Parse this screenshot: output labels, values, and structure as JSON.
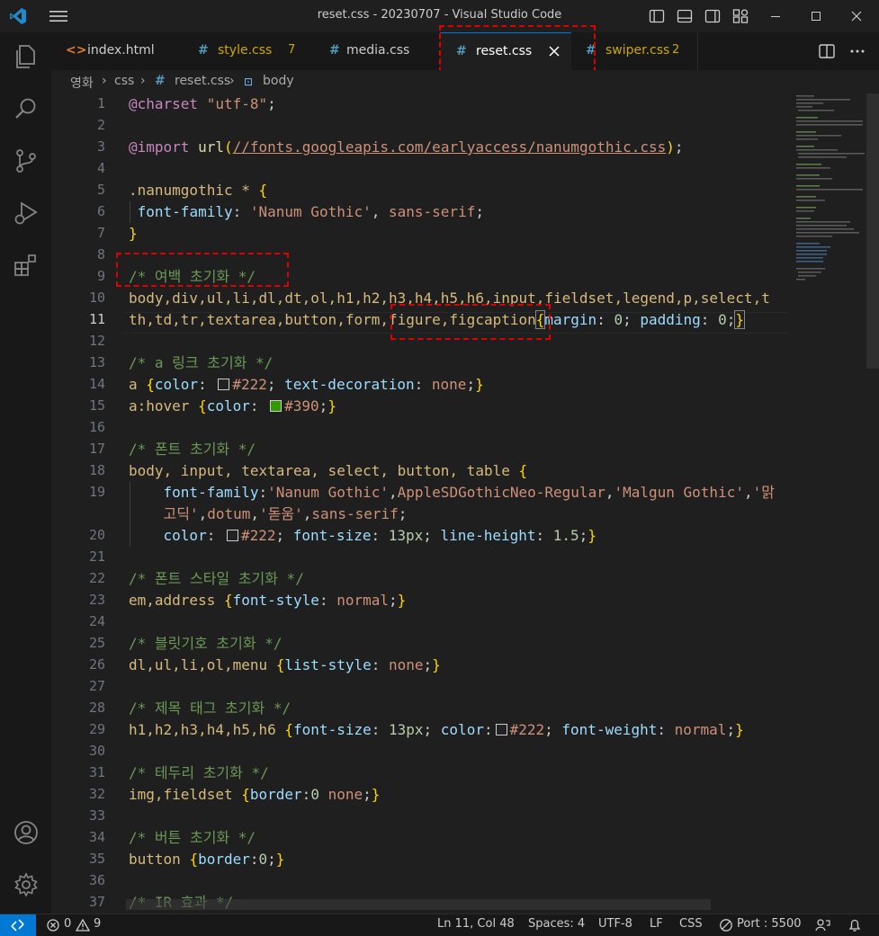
{
  "window": {
    "title": "reset.css - 20230707 - Visual Studio Code"
  },
  "tabs": [
    {
      "label": "index.html",
      "icon": "<>",
      "color": "#cccccc",
      "badge": "",
      "active": false
    },
    {
      "label": "style.css",
      "icon": "#",
      "color": "#cca700",
      "badge": "7",
      "active": false
    },
    {
      "label": "media.css",
      "icon": "#",
      "color": "#cccccc",
      "badge": "",
      "active": false
    },
    {
      "label": "reset.css",
      "icon": "#",
      "color": "#ffffff",
      "badge": "",
      "active": true
    },
    {
      "label": "swiper.css",
      "icon": "#",
      "color": "#cca700",
      "badge": "2",
      "active": false
    }
  ],
  "breadcrumb": {
    "root": "영화",
    "folder": "css",
    "file_icon": "#",
    "file": "reset.css",
    "symbol": "body"
  },
  "line_numbers": [
    "1",
    "2",
    "3",
    "4",
    "5",
    "6",
    "7",
    "8",
    "9",
    "10",
    "11",
    "12",
    "13",
    "14",
    "15",
    "16",
    "17",
    "18",
    "19",
    "20",
    "21",
    "22",
    "23",
    "24",
    "25",
    "26",
    "27",
    "28",
    "29",
    "30",
    "31",
    "32",
    "33",
    "34",
    "35",
    "36",
    "37"
  ],
  "code": {
    "l1_kw": "@charset",
    "l1_str": "\"utf-8\"",
    "semi": ";",
    "l3_kw": "@import",
    "l3_fn": "url",
    "l3_url": "//fonts.googleapis.com/earlyaccess/nanumgothic.css",
    "l5_sel": ".nanumgothic * ",
    "open": "{",
    "close": "}",
    "l6_prop": "font-family",
    "l6_str": "'Nanum Gothic'",
    "l6_val": "sans-serif",
    "l9_cmt": "/* 여백 초기화 */",
    "l10_sel": "body,div,ul,li,dl,dt,ol,h1,h2,h3,h4,h5,h6,input,fieldset,legend,p,select,t",
    "l11_sel": "th,td,tr,textarea,button,form,figure,figcaption",
    "l11_p1": "margin",
    "l11_v1": "0",
    "l11_p2": "padding",
    "l11_v2": "0",
    "l13_cmt": "/* a 링크 초기화 */",
    "l14_sel": "a ",
    "l14_p1": "color",
    "l14_v1": "#222",
    "l14_p2": "text-decoration",
    "l14_v2": "none",
    "l15_sel": "a:hover ",
    "l15_p1": "color",
    "l15_v1": "#390",
    "l17_cmt": "/* 폰트 초기화 */",
    "l18_sel": "body, input, textarea, select, button, table ",
    "l19_prop": "font-family",
    "l19_s1": "'Nanum Gothic'",
    "l19_v1": "AppleSDGothicNeo-Regular",
    "l19_s2": "'Malgun Gothic'",
    "l19_s3": "'맑",
    "l19b_s3": "고딕'",
    "l19b_v1": "dotum",
    "l19b_s4": "'돋움'",
    "l19b_v2": "sans-serif",
    "l20_p1": "color",
    "l20_v1": "#222",
    "l20_p2": "font-size",
    "l20_v2": "13px",
    "l20_p3": "line-height",
    "l20_v3": "1.5",
    "l22_cmt": "/* 폰트 스타일 초기화 */",
    "l23_sel": "em,address ",
    "l23_p1": "font-style",
    "l23_v1": "normal",
    "l25_cmt": "/* 블릿기호 초기화 */",
    "l26_sel": "dl,ul,li,ol,menu ",
    "l26_p1": "list-style",
    "l26_v1": "none",
    "l28_cmt": "/* 제목 태그 초기화 */",
    "l29_sel": "h1,h2,h3,h4,h5,h6 ",
    "l29_p1": "font-size",
    "l29_v1": "13px",
    "l29_p2": "color",
    "l29_v2": "#222",
    "l29_p3": "font-weight",
    "l29_v3": "normal",
    "l31_cmt": "/* 테두리 초기화 */",
    "l32_sel": "img,fieldset ",
    "l32_p1": "border",
    "l32_v1": "0",
    "l32_v2": "none",
    "l34_cmt": "/* 버튼 초기화 */",
    "l35_sel": "button ",
    "l35_p1": "border",
    "l35_v1": "0",
    "l37_cmt": "/* IR 효과 */"
  },
  "colors": {
    "swatch_222": "#222222",
    "swatch_390": "#339900",
    "accent": "#0078d4",
    "highlight": "#e00000"
  },
  "status": {
    "errors": "0",
    "warnings": "9",
    "position": "Ln 11, Col 48",
    "spaces": "Spaces: 4",
    "encoding": "UTF-8",
    "eol": "LF",
    "language": "CSS",
    "port": "Port : 5500"
  }
}
